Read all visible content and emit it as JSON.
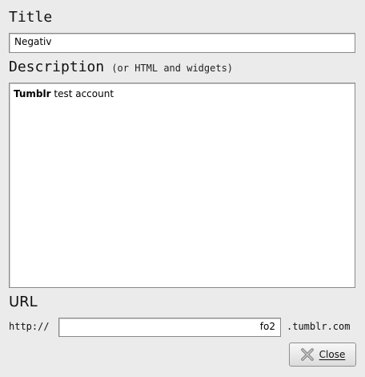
{
  "title_section": {
    "label": "Title",
    "value": "Negativ"
  },
  "description_section": {
    "label": "Description",
    "hint": "(or HTML and widgets)",
    "content_bold": "Tumblr",
    "content_rest": " test account"
  },
  "url_section": {
    "label": "URL",
    "prefix": "http://",
    "value": "fo2",
    "suffix": ".tumblr.com"
  },
  "footer": {
    "close_label": "Close",
    "close_icon": "close-x-icon"
  }
}
